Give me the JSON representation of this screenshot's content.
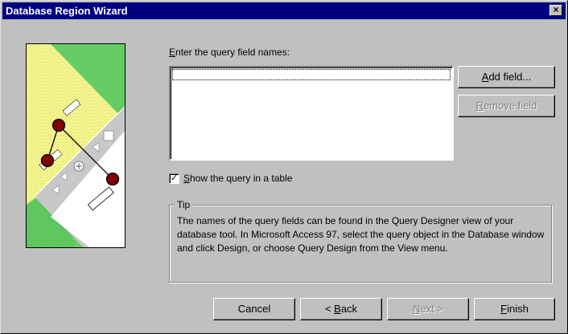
{
  "window": {
    "title": "Database Region Wizard",
    "close_glyph": "×"
  },
  "fields": {
    "label_prefix": "E",
    "label_rest": "nter the query field names:",
    "items": [
      ""
    ]
  },
  "buttons": {
    "add_field_prefix": "A",
    "add_field_rest": "dd field...",
    "remove_field_prefix": "R",
    "remove_field_rest": "emove field",
    "cancel": "Cancel",
    "back_prefix": "< ",
    "back_key": "B",
    "back_rest": "ack",
    "next_key": "N",
    "next_rest": "ext >",
    "finish_key": "F",
    "finish_rest": "inish"
  },
  "option": {
    "checked": true,
    "check_glyph": "✓",
    "label_key": "S",
    "label_rest": "how the query in a table"
  },
  "tip": {
    "legend": "Tip",
    "text": "The names of the query fields can be found in the Query Designer view of your database tool.  In Microsoft Access 97, select the query object in the Database window and click Design, or choose Query Design from the View menu."
  },
  "colors": {
    "titlebar": "#000080",
    "map_green": "#66cc66",
    "map_yellow": "#ffff99",
    "marker": "#800000"
  }
}
